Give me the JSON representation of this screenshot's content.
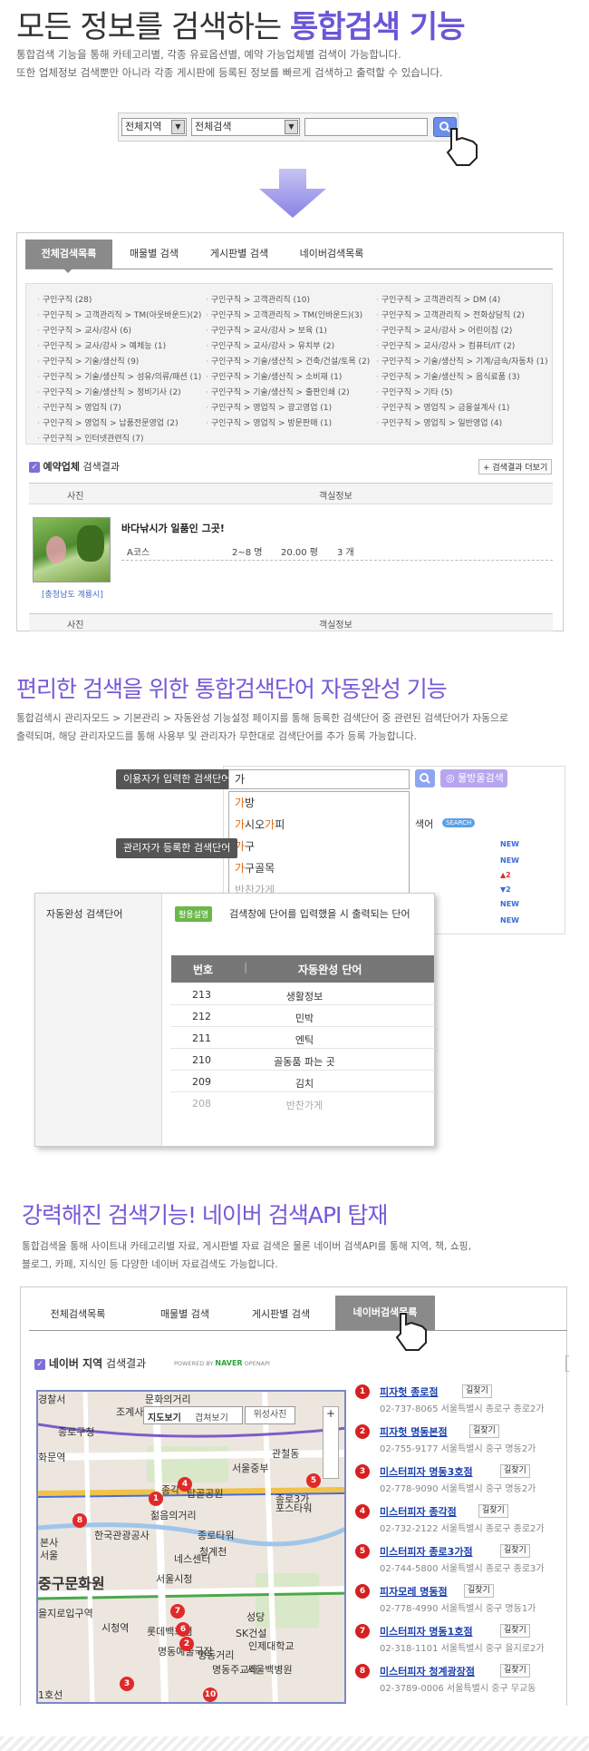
{
  "section1": {
    "title_plain": "모든 정보를 검색하는 ",
    "title_bold": "통합검색 기능",
    "desc1": "통합검색 기능을 통해 카테고리별, 각종 유료옵션별, 예약 가능업체별 검색이 가능합니다.",
    "desc2": "또한 업체정보 검색뿐만 아니라 각종 게시판에 등록된 정보를 빠르게 검색하고 출력할 수 있습니다.",
    "region_select": "전체지역",
    "scope_select": "전체검색",
    "tabs": [
      "전체검색목록",
      "매물별 검색",
      "게시판별 검색",
      "네이버검색목록"
    ],
    "categories": [
      [
        "구인구직 (28)",
        "구인구직 > 고객관리직 (10)",
        "구인구직 > 고객관리직 > DM (4)"
      ],
      [
        "구인구직 > 고객관리직 > TM(아웃바운드)(2)",
        "구인구직 > 고객관리직 > TM(인바운드)(3)",
        "구인구직 > 고객관리직 > 전화상담직 (2)"
      ],
      [
        "구인구직 > 교사/강사 (6)",
        "구인구직 > 교사/강사 > 보육 (1)",
        "구인구직 > 교사/강사 > 어린이집 (2)"
      ],
      [
        "구인구직 > 교사/강사 > 예체능 (1)",
        "구인구직 > 교사/강사 > 유치부 (2)",
        "구인구직 > 교사/강사 > 컴퓨터/IT (2)"
      ],
      [
        "구인구직 > 기술/생산직 (9)",
        "구인구직 > 기술/생산직 > 건축/건설/토목 (2)",
        "구인구직 > 기술/생산직 > 기계/금속/자동차 (1)"
      ],
      [
        "구인구직 > 기술/생산직 > 섬유/의류/패션 (1)",
        "구인구직 > 기술/생산직 > 소비재 (1)",
        "구인구직 > 기술/생산직 > 음식료품 (3)"
      ],
      [
        "구인구직 > 기술/생산직 > 정비기사 (2)",
        "구인구직 > 기술/생산직 > 출판인쇄 (2)",
        "구인구직 > 기타 (5)"
      ],
      [
        "구인구직 > 영업직 (7)",
        "구인구직 > 영업직 > 광고영업 (1)",
        "구인구직 > 영업직 > 금융설계사 (1)"
      ],
      [
        "구인구직 > 영업직 > 납품전문영업 (2)",
        "구인구직 > 영업직 > 방문판매 (1)",
        "구인구직 > 영업직 > 일반영업 (4)"
      ],
      [
        "구인구직 > 인터넷관련직 (7)",
        "",
        ""
      ]
    ],
    "reserve_label": "예약업체",
    "reserve_suffix": " 검색결과",
    "more_button": "검색결과 더보기",
    "col_photo": "사진",
    "col_info": "객실정보",
    "listing_title": "바다낚시가 일품인 그곳!",
    "listing_course": "A코스",
    "listing_people": "2~8 명",
    "listing_area": "20.00 평",
    "listing_count": "3 개",
    "listing_region": "[충청남도 계룡시]"
  },
  "section2": {
    "title": "편리한 검색을 위한 통합검색단어 자동완성 기능",
    "desc1": "통합검색시 관리자모드 > 기본관리 > 자동완성 기능설정 페이지를 통해 등록한 검색단어 중 관련된 검색단어가 자동으로",
    "desc2": "출력되며, 해당 관리자모드를 통해 사용부 및 관리자가 무한대로 검색단어를 추가 등록 가능합니다.",
    "user_tag": "이용자가 입력한 검색단어",
    "admin_tag": "관리자가 등록한 검색단어",
    "typed": "가",
    "map_search_btn": "물방울검색",
    "suggestions": [
      {
        "hl": "가",
        "rest": "방"
      },
      {
        "hl": "가",
        "rest": "시오",
        "hl2": "가",
        "rest2": "피"
      },
      {
        "hl": "가",
        "rest": "구"
      },
      {
        "hl": "가",
        "rest": "구골목"
      },
      {
        "hl": "",
        "rest": "반찬가게"
      }
    ],
    "side_label": "색어",
    "side_badge": "SEARCH",
    "new_badge": "NEW",
    "rank_up": "▲2",
    "rank_down": "▼2",
    "admin_label": "자동완성 검색단어",
    "usage_badge": "활용설명",
    "usage_text": "검색창에 단어를 입력했을 시 출력되는 단어",
    "th_no": "번호",
    "th_word": "자동완성 단어",
    "rows": [
      {
        "no": "213",
        "word": "생활정보"
      },
      {
        "no": "212",
        "word": "민박"
      },
      {
        "no": "211",
        "word": "엔틱"
      },
      {
        "no": "210",
        "word": "골동품 파는 곳"
      },
      {
        "no": "209",
        "word": "김치"
      },
      {
        "no": "208",
        "word": "반찬가게"
      }
    ]
  },
  "section3": {
    "title": "강력해진 검색기능! 네이버 검색API 탑재",
    "desc1": "통합검색을 통해 사이트내 카테고리별 자료, 게시판별 자료 검색은 물론 네이버 검색API를 통해 지역, 책, 쇼핑,",
    "desc2": "블로그, 카페, 지식인 등 다양한 네이버 자료검색도 가능합니다.",
    "tabs": [
      "전체검색목록",
      "매물별 검색",
      "게시판별 검색",
      "네이버검색목록"
    ],
    "naver_label": "네이버 지역",
    "naver_suffix": " 검색결과",
    "powered_by": "POWERED BY",
    "naver": "NAVER",
    "openapi": "OPENAPI",
    "map_btns": [
      "지도보기",
      "겹쳐보기",
      "위성사진"
    ],
    "map_labels": [
      "문화의거리",
      "종로구청",
      "관철동",
      "조계사",
      "화문역",
      "종각",
      "젊음의거리",
      "한국관광공사",
      "본사",
      "서울",
      "네스센터",
      "종로타워",
      "청계천",
      "중구문화원",
      "서울시청",
      "을지로입구역",
      "시청역",
      "롯데백화점",
      "명동예술극장",
      "명동거리",
      "명동주교좌",
      "성당",
      "SK건설",
      "인제대학교",
      "서울백병원",
      "서울중부",
      "경찰서",
      "탑골공원",
      "종로3가",
      "1호선",
      "포스타워",
      "서울시"
    ],
    "results": [
      {
        "name": "피자헛 종로점",
        "addr": "02-737-8065 서울특별시 종로구 종로2가"
      },
      {
        "name": "피자헛 명동본점",
        "addr": "02-755-9177 서울특별시 중구 명동2가"
      },
      {
        "name": "미스터피자 명동3호점",
        "addr": "02-778-9090 서울특별시 중구 명동2가"
      },
      {
        "name": "미스터피자 종각점",
        "addr": "02-732-2122 서울특별시 종로구 종로2가"
      },
      {
        "name": "미스터피자 종로3가점",
        "addr": "02-744-5800 서울특별시 종로구 종로3가"
      },
      {
        "name": "피자모레 명동점",
        "addr": "02-778-4990 서울특별시 중구 명동1가"
      },
      {
        "name": "미스터피자 명동1호점",
        "addr": "02-318-1101 서울특별시 중구 을지로2가"
      },
      {
        "name": "미스터피자 청계광장점",
        "addr": "02-3789-0006 서울특별시 중구 무교동"
      }
    ],
    "find_way": "길찾기"
  }
}
